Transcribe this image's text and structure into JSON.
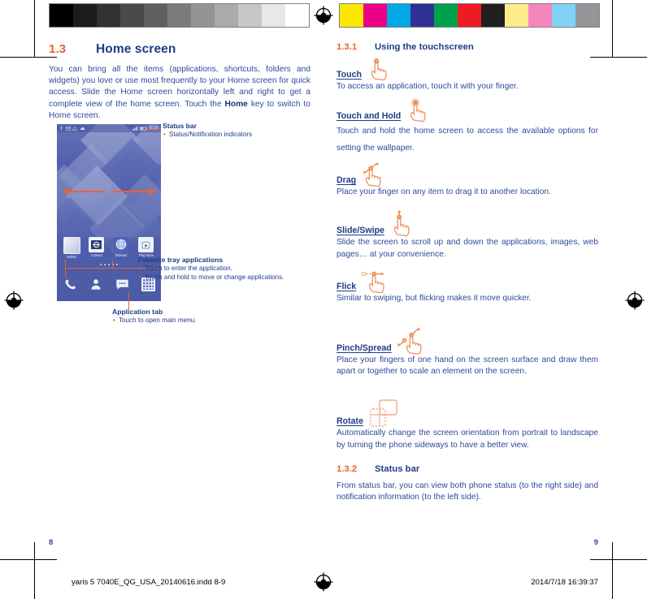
{
  "printer_marks": {
    "gray_strip": [
      "#000000",
      "#1c1c1c",
      "#313131",
      "#4a4a4a",
      "#5f5f5f",
      "#7b7b7b",
      "#949494",
      "#ababab",
      "#c7c7c7",
      "#e8e8e8",
      "#ffffff"
    ],
    "color_strip": [
      "#ffe800",
      "#ec0089",
      "#00a9e6",
      "#2e3192",
      "#00a14b",
      "#ed1c24",
      "#231f20",
      "#fdec8a",
      "#f485bd",
      "#7fd4f5",
      "#939598"
    ],
    "registration_icon": "registration-target-icon"
  },
  "left_page": {
    "section": {
      "number": "1.3",
      "title": "Home screen"
    },
    "intro": "You can bring all the items (applications, shortcuts, folders and widgets) you love or use most frequently to your Home screen for quick access. Slide the Home screen horizontally left and right to get a complete view of the home screen. Touch the ",
    "intro_bold": "Home",
    "intro_tail": " key to switch to Home screen.",
    "page_number": "8"
  },
  "phone": {
    "status_bar": {
      "left_icons": [
        "usb-icon",
        "mail-icon",
        "warning-icon",
        "sim-icon"
      ],
      "right_icons": [
        "signal-icon",
        "battery-icon"
      ],
      "clock": "00:25"
    },
    "app_row": [
      {
        "label": "Gallery",
        "icon": "gallery-icon"
      },
      {
        "label": "Camera",
        "icon": "camera-icon"
      },
      {
        "label": "Browser",
        "icon": "browser-icon"
      },
      {
        "label": "Play Store",
        "icon": "play-store-icon"
      }
    ],
    "page_dots": 5,
    "tray": [
      {
        "icon": "phone-icon"
      },
      {
        "icon": "contacts-icon"
      },
      {
        "icon": "messaging-icon"
      },
      {
        "icon": "app-drawer-icon"
      }
    ]
  },
  "callouts": {
    "status_bar": {
      "title": "Status bar",
      "items": [
        "Status/Notification indicators"
      ]
    },
    "favorite_tray": {
      "title": "Favorite tray applications",
      "items": [
        "Touch to enter the application.",
        "Touch and hold to move or change applications."
      ]
    },
    "application_tab": {
      "title": "Application tab",
      "items": [
        "Touch to open main menu."
      ]
    }
  },
  "right_page": {
    "section_1": {
      "number": "1.3.1",
      "title": "Using the touchscreen"
    },
    "gestures": [
      {
        "term": "Touch",
        "icon": "touch-hand-icon",
        "text": "To access an application, touch it with your finger."
      },
      {
        "term": "Touch and Hold",
        "icon": "touch-hold-hand-icon",
        "text": "Touch and hold the home screen to access the available options for setting the wallpaper."
      },
      {
        "term": "Drag",
        "icon": "drag-hand-icon",
        "text": "Place your finger on any item to drag it to another location."
      },
      {
        "term": "Slide/Swipe",
        "icon": "slide-hand-icon",
        "text": "Slide the screen to scroll up and down the applications, images, web pages… at your convenience."
      },
      {
        "term": "Flick",
        "icon": "flick-hand-icon",
        "text": "Similar to swiping, but flicking makes it move quicker."
      },
      {
        "term": "Pinch/Spread",
        "icon": "pinch-spread-hand-icon",
        "text": "Place your fingers of one hand on the screen surface and draw them apart or together to scale an element on the screen."
      },
      {
        "term": "Rotate",
        "icon": "rotate-phone-icon",
        "text": "Automatically change the screen orientation from portrait to landscape by turning the phone sideways to have a better view."
      }
    ],
    "section_2": {
      "number": "1.3.2",
      "title": "Status bar"
    },
    "status_bar_text": "From status bar, you can view both phone status (to the right side) and notification information (to the left side).",
    "page_number": "9"
  },
  "footer": {
    "file_name": "yaris 5 7040E_QG_USA_20140616.indd   8-9",
    "timestamp": "2014/7/18   16:39:37"
  },
  "colors": {
    "heading_blue": "#1f3c88",
    "body_blue": "#2b4a9b",
    "accent_orange": "#e8622a"
  }
}
